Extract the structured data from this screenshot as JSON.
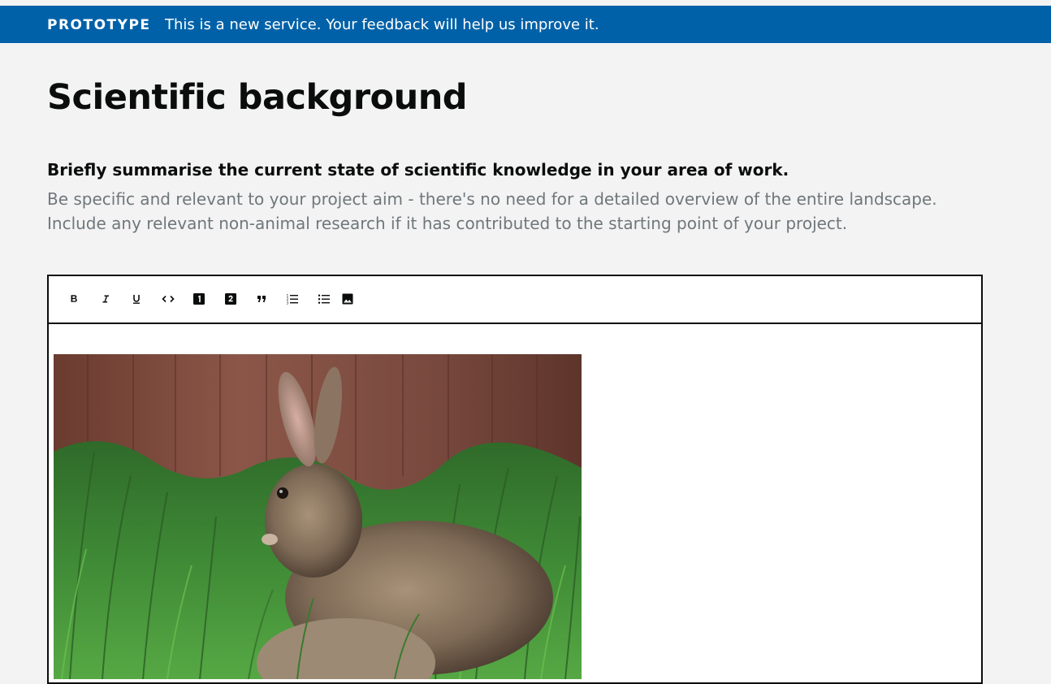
{
  "phase_banner": {
    "tag": "PROTOTYPE",
    "text": "This is a new service. Your feedback will help us improve it."
  },
  "page": {
    "title": "Scientific background"
  },
  "question": {
    "label": "Briefly summarise the current state of scientific knowledge in your area of work.",
    "hint": "Be specific and relevant to your project aim - there's no need for a detailed overview of the entire landscape. Include any relevant non-animal research if it has contributed to the starting point of your project."
  },
  "editor": {
    "toolbar": [
      {
        "name": "bold-button",
        "icon": "bold-icon"
      },
      {
        "name": "italic-button",
        "icon": "italic-icon"
      },
      {
        "name": "underline-button",
        "icon": "underline-icon"
      },
      {
        "name": "code-button",
        "icon": "code-icon"
      },
      {
        "name": "heading-one-button",
        "icon": "heading-one-icon"
      },
      {
        "name": "heading-two-button",
        "icon": "heading-two-icon"
      },
      {
        "name": "block-quote-button",
        "icon": "quote-icon"
      },
      {
        "name": "numbered-list-button",
        "icon": "numbered-list-icon"
      },
      {
        "name": "bulleted-list-button",
        "icon": "bulleted-list-icon"
      },
      {
        "name": "insert-image-button",
        "icon": "image-icon"
      }
    ],
    "image": {
      "subject": "rabbit-in-grass-photo"
    }
  },
  "colors": {
    "banner_blue": "#0061a8",
    "page_background": "#f3f3f3",
    "text": "#0b0c0c",
    "hint_text": "#6f777b",
    "editor_border": "#0b0c0c"
  }
}
